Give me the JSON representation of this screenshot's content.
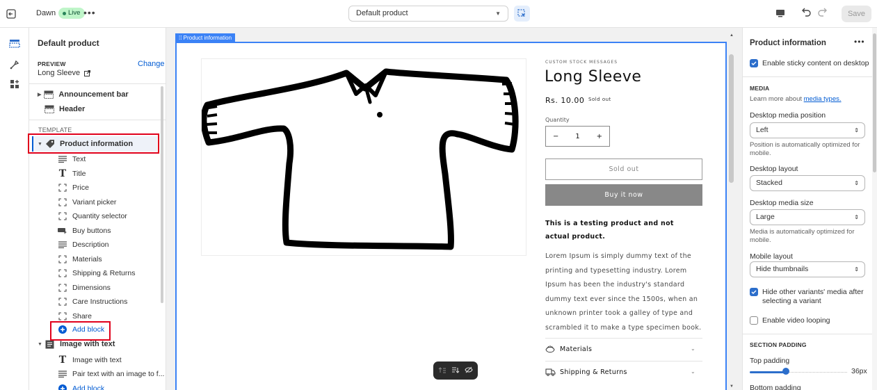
{
  "topbar": {
    "theme_name": "Dawn",
    "live_badge": "Live",
    "more": "•••",
    "template_select": "Default product",
    "save": "Save"
  },
  "sidebar": {
    "title": "Default product",
    "preview_label": "PREVIEW",
    "change": "Change",
    "preview_product": "Long Sleeve",
    "sections_top": [
      "Announcement bar",
      "Header"
    ],
    "template_label": "TEMPLATE",
    "product_section": "Product information",
    "blocks": [
      {
        "label": "Text",
        "icon": "text-lines-icon"
      },
      {
        "label": "Title",
        "icon": "title-icon"
      },
      {
        "label": "Price",
        "icon": "block-icon"
      },
      {
        "label": "Variant picker",
        "icon": "block-icon"
      },
      {
        "label": "Quantity selector",
        "icon": "block-icon"
      },
      {
        "label": "Buy buttons",
        "icon": "buy-buttons-icon"
      },
      {
        "label": "Description",
        "icon": "text-lines-icon"
      },
      {
        "label": "Materials",
        "icon": "block-icon"
      },
      {
        "label": "Shipping & Returns",
        "icon": "block-icon"
      },
      {
        "label": "Dimensions",
        "icon": "block-icon"
      },
      {
        "label": "Care Instructions",
        "icon": "block-icon"
      },
      {
        "label": "Share",
        "icon": "block-icon"
      }
    ],
    "add_block": "Add block",
    "image_with_text": "Image with text",
    "iwt_blocks": [
      {
        "label": "Image with text",
        "icon": "title-icon"
      },
      {
        "label": "Pair text with an image to f...",
        "icon": "text-lines-icon"
      }
    ],
    "add_block_2": "Add block"
  },
  "preview": {
    "frame_label": "Product information",
    "vendor": "CUSTOM STOCK MESSAGES",
    "title": "Long Sleeve",
    "price": "Rs. 10.00",
    "sold_tag": "Sold out",
    "quantity_label": "Quantity",
    "quantity_value": "1",
    "minus": "−",
    "plus": "+",
    "sold_out_button": "Sold out",
    "buy_now_button": "Buy it now",
    "strong_text": "This is a testing product and not actual product.",
    "description": "Lorem Ipsum is simply dummy text of the printing and typesetting industry. Lorem Ipsum has been the industry's standard dummy text ever since the 1500s, when an unknown printer took a galley of type and scrambled it to make a type specimen book.",
    "accordions": [
      "Materials",
      "Shipping & Returns"
    ]
  },
  "settings": {
    "title": "Product information",
    "more": "•••",
    "sticky": "Enable sticky content on desktop",
    "media_heading": "MEDIA",
    "learn_prefix": "Learn more about ",
    "learn_link": "media types.",
    "desktop_media_position_label": "Desktop media position",
    "desktop_media_position": "Left",
    "position_help": "Position is automatically optimized for mobile.",
    "desktop_layout_label": "Desktop layout",
    "desktop_layout": "Stacked",
    "desktop_media_size_label": "Desktop media size",
    "desktop_media_size": "Large",
    "media_size_help": "Media is automatically optimized for mobile.",
    "mobile_layout_label": "Mobile layout",
    "mobile_layout": "Hide thumbnails",
    "hide_variants": "Hide other variants' media after selecting a variant",
    "video_looping": "Enable video looping",
    "section_padding_heading": "SECTION PADDING",
    "top_padding_label": "Top padding",
    "top_padding_value": "36px",
    "top_padding_fraction": 0.36,
    "bottom_padding_label": "Bottom padding"
  },
  "colors": {
    "accent": "#005bd3",
    "live_bg": "#bff5c9",
    "highlight_red": "#e0001b",
    "frame_blue": "#3b82f6"
  }
}
